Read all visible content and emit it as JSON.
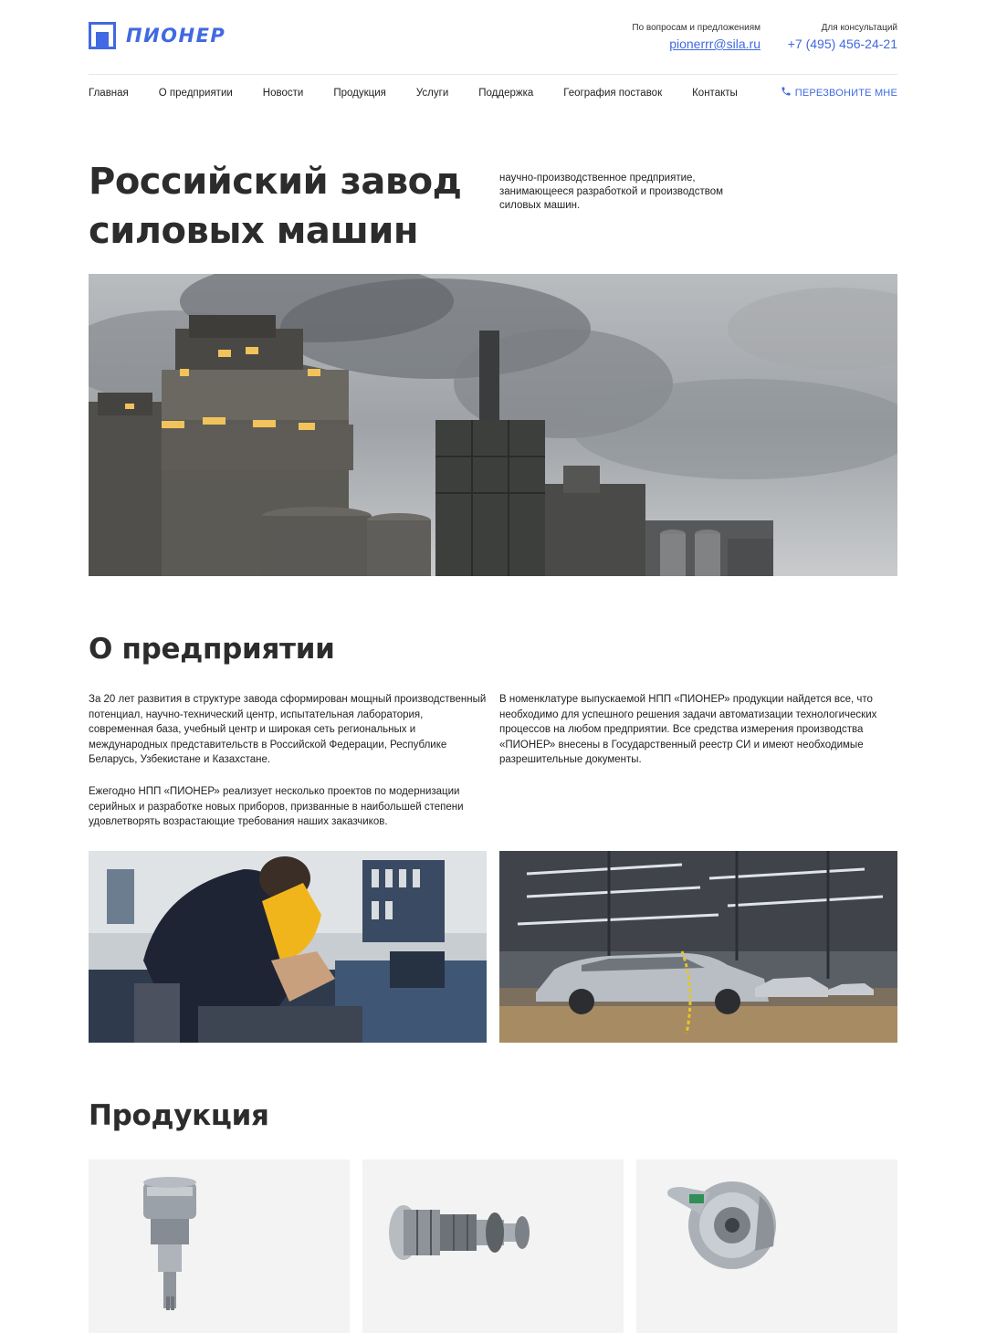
{
  "header": {
    "logo_text": "ПИОНЕР",
    "email_caption": "По вопросам и предложениям",
    "email": "pionerrr@sila.ru",
    "phone_caption": "Для консультаций",
    "phone": "+7 (495) 456-24-21"
  },
  "nav": {
    "items": [
      "Главная",
      "О предприятии",
      "Новости",
      "Продукция",
      "Услуги",
      "Поддержка",
      "География поставок",
      "Контакты"
    ],
    "callback_label": "ПЕРЕЗВОНИТЕ МНЕ"
  },
  "hero": {
    "title_line1": "Российский завод",
    "title_line2": "силовых машин",
    "description": "научно-производственное предприятие, занимающееся разработкой и производством силовых машин."
  },
  "about": {
    "title": "О предприятии",
    "paragraph1": "За 20 лет развития в структуре завода сформирован мощный производственный потенциал, научно-технический центр, испытательная лаборатория, современная база, учебный центр и широкая сеть региональных и международных представительств в Российской Федерации, Республике Беларусь, Узбекистане и Казахстане.",
    "paragraph2": "Ежегодно НПП «ПИОНЕР» реализует несколько проектов по модернизации серийных и разработке новых приборов, призванные в наибольшей степени удовлетворять возрастающие требования наших заказчиков.",
    "paragraph3": "В номенклатуре выпускаемой НПП «ПИОНЕР» продукции найдется все, что необходимо для успешного решения задачи автоматизации технологических процессов на любом предприятии. Все средства измерения производства «ПИОНЕР» внесены в Государственный реестр СИ и имеют необходимые разрешительные документы."
  },
  "products": {
    "title": "Продукция"
  },
  "colors": {
    "accent": "#4169e1",
    "text": "#2b2b2b",
    "card_bg": "#f3f3f3",
    "divider": "#e6e6e6"
  },
  "icons": {
    "logo": "logo-square-icon",
    "callback": "phone-icon"
  }
}
